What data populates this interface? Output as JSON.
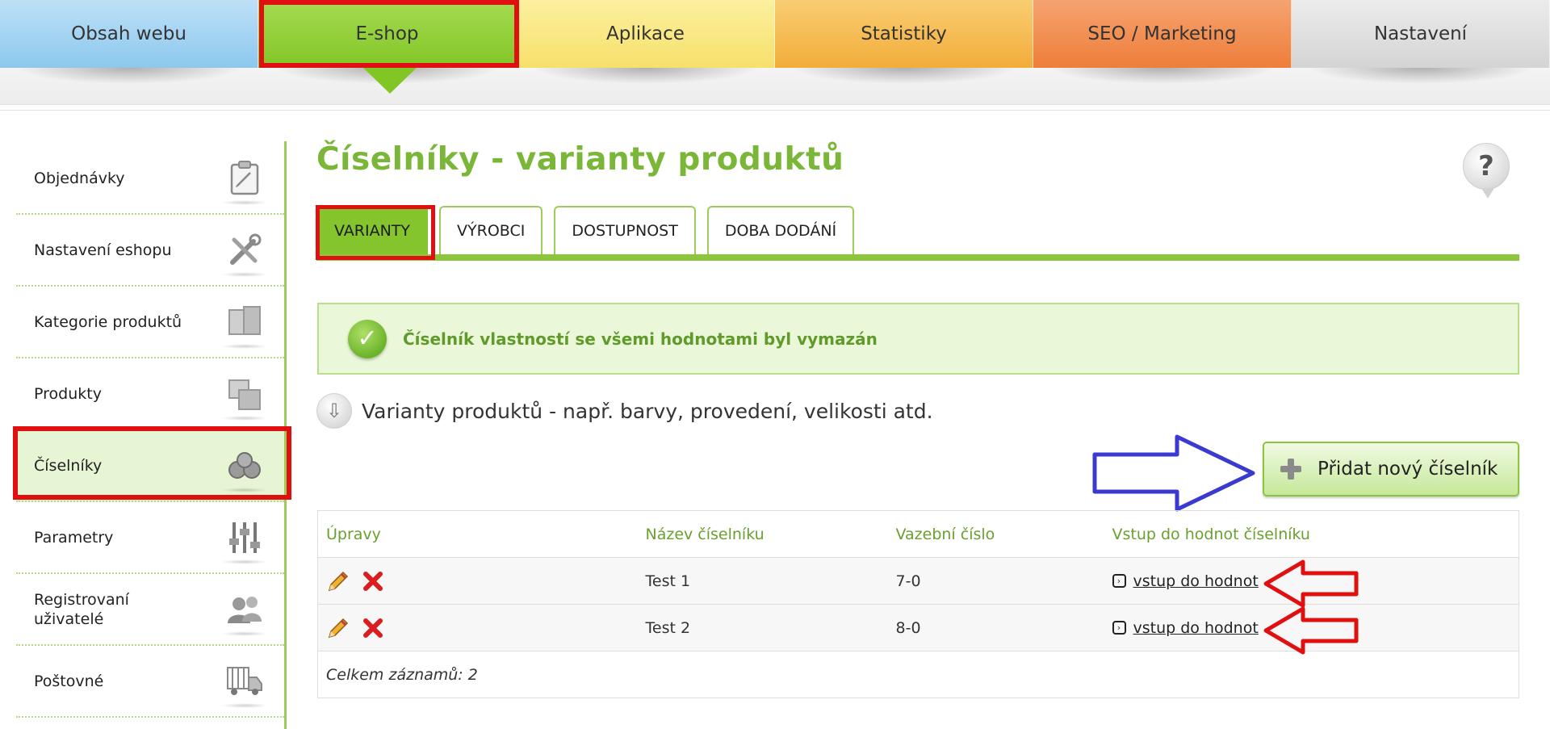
{
  "topnav": {
    "tabs": [
      {
        "label": "Obsah webu"
      },
      {
        "label": "E-shop"
      },
      {
        "label": "Aplikace"
      },
      {
        "label": "Statistiky"
      },
      {
        "label": "SEO / Marketing"
      },
      {
        "label": "Nastavení"
      }
    ],
    "active": "E-shop",
    "colors": [
      "#8cc8ee",
      "#82c626",
      "#f7e06a",
      "#f2ad3a",
      "#ee7e3a",
      "#d4d4d4"
    ]
  },
  "sidebar": {
    "items": [
      {
        "label": "Objednávky",
        "icon": "clipboard-icon"
      },
      {
        "label": "Nastavení eshopu",
        "icon": "tools-icon"
      },
      {
        "label": "Kategorie produktů",
        "icon": "boxes-icon"
      },
      {
        "label": "Produkty",
        "icon": "products-icon"
      },
      {
        "label": "Číselníky",
        "icon": "coins-icon"
      },
      {
        "label": "Parametry",
        "icon": "sliders-icon"
      },
      {
        "label": "Registrovaní uživatelé",
        "icon": "users-icon"
      },
      {
        "label": "Poštovné",
        "icon": "truck-icon"
      }
    ],
    "active": "Číselníky"
  },
  "page": {
    "title": "Číselníky - varianty produktů",
    "help": "?"
  },
  "subtabs": {
    "items": [
      {
        "label": "VARIANTY"
      },
      {
        "label": "VÝROBCI"
      },
      {
        "label": "DOSTUPNOST"
      },
      {
        "label": "DOBA DODÁNÍ"
      }
    ],
    "active": "VARIANTY"
  },
  "message": {
    "success": "Číselník vlastností se všemi hodnotami byl vymazán"
  },
  "info": {
    "text": "Varianty produktů - např. barvy, provedení, velikosti atd."
  },
  "actions": {
    "add_label": "Přidat nový číselník"
  },
  "table": {
    "columns": [
      "Úpravy",
      "Název číselníku",
      "Vazební číslo",
      "Vstup do hodnot číselníku"
    ],
    "rows": [
      {
        "name": "Test 1",
        "code": "7-0",
        "link": "vstup do hodnot"
      },
      {
        "name": "Test 2",
        "code": "8-0",
        "link": "vstup do hodnot"
      }
    ],
    "footer": "Celkem záznamů: 2"
  },
  "colors": {
    "accent_green": "#7ab638",
    "annotation_red": "#e01010",
    "annotation_blue": "#3a3ad0"
  }
}
